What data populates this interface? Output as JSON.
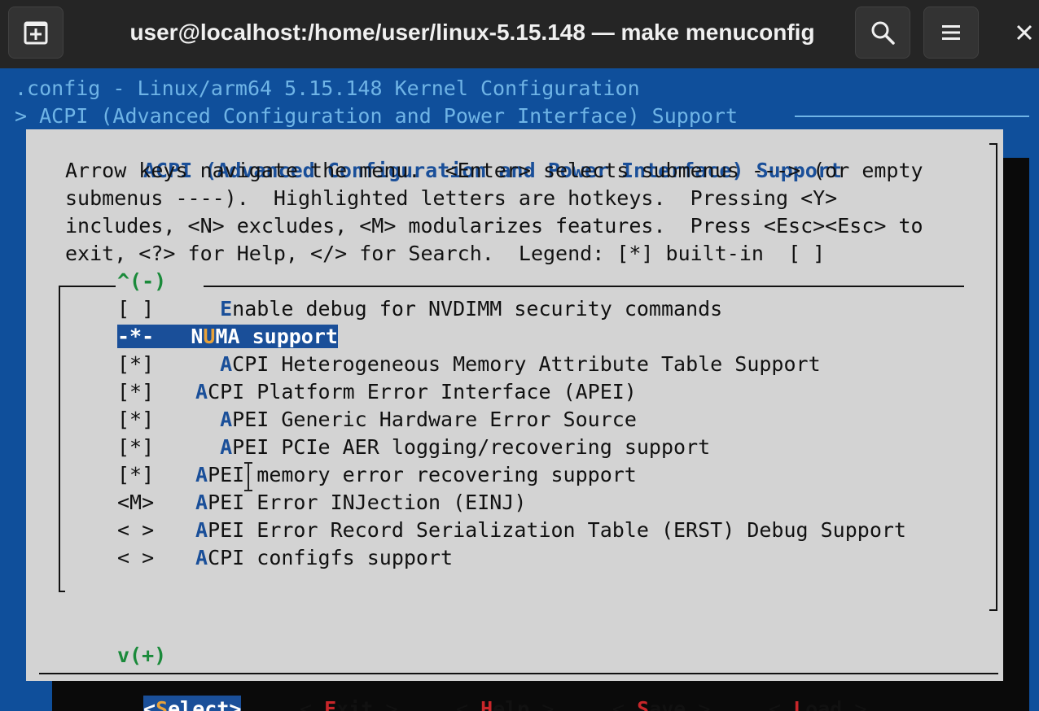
{
  "window": {
    "title": "user@localhost:/home/user/linux-5.15.148 — make menuconfig",
    "icons": [
      "new-tab-icon",
      "search-icon",
      "hamburger-menu-icon",
      "close-icon"
    ]
  },
  "terminal": {
    "config_title": ".config - Linux/arm64 5.15.148 Kernel Configuration",
    "breadcrumb": "> ACPI (Advanced Configuration and Power Interface) Support"
  },
  "dialog": {
    "title": "ACPI (Advanced Configuration and Power Interface) Support",
    "help_lines": [
      "Arrow keys navigate the menu.  <Enter> selects submenus ---> (or empty",
      "submenus ----).  Highlighted letters are hotkeys.  Pressing <Y>",
      "includes, <N> excludes, <M> modularizes features.  Press <Esc><Esc> to",
      "exit, <?> for Help, </> for Search.  Legend: [*] built-in  [ ]"
    ],
    "scroll_up": "^(-)",
    "scroll_down": "v(+)",
    "items": [
      {
        "state": "[ ]",
        "indent": "  ",
        "hotkey": "E",
        "rest": "nable debug for NVDIMM security commands"
      },
      {
        "state": "-*-",
        "indent": "",
        "pre": "N",
        "hotkey": "U",
        "rest": "MA support",
        "selected": true
      },
      {
        "state": "[*]",
        "indent": "  ",
        "hotkey": "A",
        "rest": "CPI Heterogeneous Memory Attribute Table Support"
      },
      {
        "state": "[*]",
        "indent": "",
        "hotkey": "A",
        "rest": "CPI Platform Error Interface (APEI)"
      },
      {
        "state": "[*]",
        "indent": "  ",
        "hotkey": "A",
        "rest": "PEI Generic Hardware Error Source"
      },
      {
        "state": "[*]",
        "indent": "  ",
        "hotkey": "A",
        "rest": "PEI PCIe AER logging/recovering support"
      },
      {
        "state": "[*]",
        "indent": "",
        "hotkey": "A",
        "rest": "PEI memory error recovering support"
      },
      {
        "state": "<M>",
        "indent": "",
        "hotkey": "A",
        "rest": "PEI Error INJection (EINJ)"
      },
      {
        "state": "< >",
        "indent": "",
        "hotkey": "A",
        "rest": "PEI Error Record Serialization Table (ERST) Debug Support"
      },
      {
        "state": "< >",
        "indent": "",
        "hotkey": "A",
        "rest": "CPI configfs support"
      }
    ],
    "buttons": [
      {
        "open": "<",
        "hotkey": "S",
        "rest": "elect",
        "close": ">",
        "active": true
      },
      {
        "open": "< ",
        "hotkey": "E",
        "rest": "xit",
        "close": " >"
      },
      {
        "open": "< ",
        "hotkey": "H",
        "rest": "elp",
        "close": " >"
      },
      {
        "open": "< ",
        "hotkey": "S",
        "rest": "ave",
        "close": " >"
      },
      {
        "open": "< ",
        "hotkey": "L",
        "rest": "oad",
        "close": " >"
      }
    ]
  }
}
